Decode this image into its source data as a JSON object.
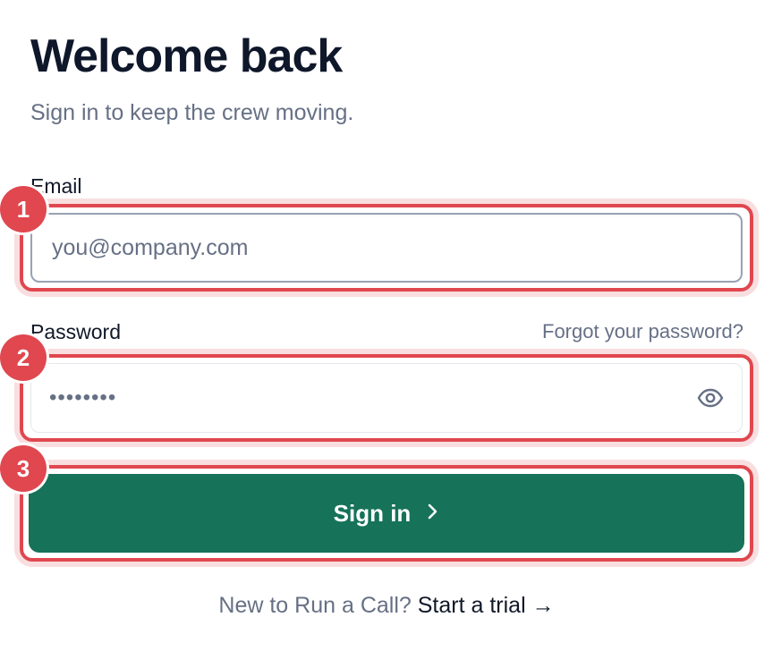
{
  "header": {
    "title": "Welcome back",
    "subtitle": "Sign in to keep the crew moving."
  },
  "form": {
    "email_label": "Email",
    "email_placeholder": "you@company.com",
    "password_label": "Password",
    "forgot_label": "Forgot your password?",
    "password_masked": "••••••••",
    "password_toggle_icon": "eye-icon",
    "submit_label": "Sign in",
    "submit_icon": "chevron-right-icon"
  },
  "footer": {
    "prompt": "New to Run a Call?",
    "link_label": "Start a trial →"
  },
  "annotations": {
    "markers": [
      "1",
      "2",
      "3"
    ],
    "highlight_color": "#e0474f"
  },
  "colors": {
    "primary": "#167259",
    "muted_text": "#667085",
    "heading": "#0f172a"
  }
}
